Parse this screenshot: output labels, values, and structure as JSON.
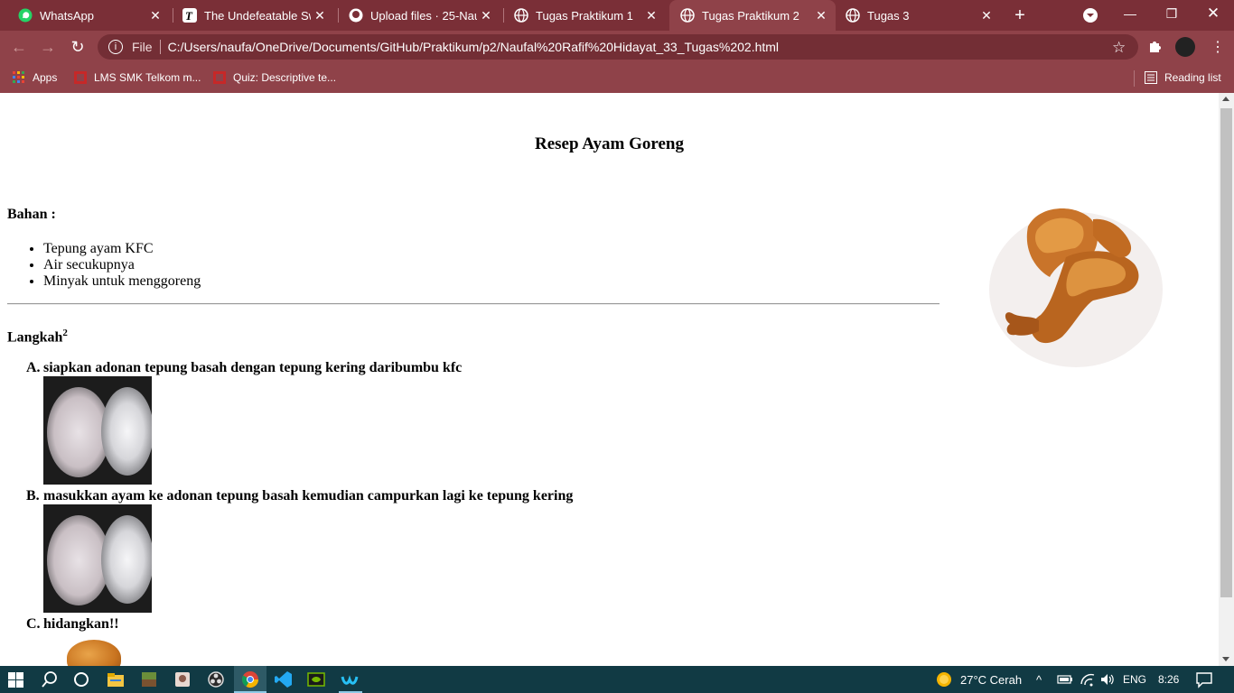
{
  "tabs": [
    {
      "title": "WhatsApp",
      "icon": "whatsapp-icon",
      "active": false
    },
    {
      "title": "The Undefeatable Swo",
      "icon": "t-logo-icon",
      "active": false
    },
    {
      "title": "Upload files · 25-Naufa",
      "icon": "github-icon",
      "active": false
    },
    {
      "title": "Tugas Praktikum 1",
      "icon": "globe-icon",
      "active": false
    },
    {
      "title": "Tugas Praktikum 2",
      "icon": "globe-icon",
      "active": true
    },
    {
      "title": "Tugas 3",
      "icon": "globe-icon",
      "active": false
    }
  ],
  "address_bar": {
    "scheme_label": "File",
    "url": "C:/Users/naufa/OneDrive/Documents/GitHub/Praktikum/p2/Naufal%20Rafif%20Hidayat_33_Tugas%202.html"
  },
  "bookmarks": [
    {
      "label": "Apps",
      "icon": "apps-grid-icon"
    },
    {
      "label": "LMS SMK Telkom m...",
      "icon": "lms-icon"
    },
    {
      "label": "Quiz: Descriptive te...",
      "icon": "lms-icon"
    }
  ],
  "reading_list": "Reading list",
  "page": {
    "title": "Resep Ayam Goreng",
    "bahan_label": "Bahan :",
    "ingredients": [
      "Tepung ayam KFC",
      "Air secukupnya",
      "Minyak untuk menggoreng"
    ],
    "langkah_label": "Langkah",
    "langkah_sup": "2",
    "steps": [
      {
        "letter": "A.",
        "text": "siapkan adonan tepung basah dengan tepung kering daribumbu kfc"
      },
      {
        "letter": "B.",
        "text": "masukkan ayam ke adonan tepung basah kemudian campurkan lagi ke tepung kering"
      },
      {
        "letter": "C.",
        "text": "hidangkan!!"
      }
    ]
  },
  "taskbar": {
    "weather": "27°C  Cerah",
    "language": "ENG",
    "time": "8:26"
  },
  "colors": {
    "tabstrip": "#7a2f37",
    "toolbar": "#8f4249",
    "taskbar": "#113a44"
  }
}
